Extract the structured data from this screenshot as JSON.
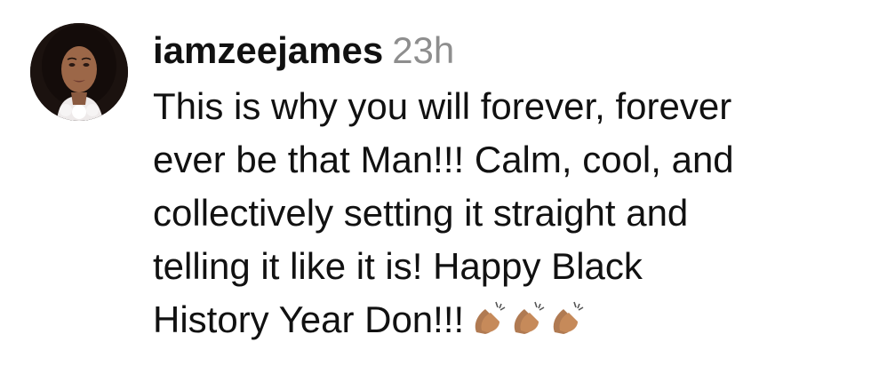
{
  "comment": {
    "username": "iamzeejames",
    "timestamp": "23h",
    "lines": [
      "This is why you will forever, forever",
      "ever be that Man!!! Calm, cool, and",
      "collectively setting it straight and",
      "telling it like it is! Happy Black",
      "History Year Don!!!"
    ],
    "emoji": "👏🏾👏🏾👏🏾",
    "emoji_icon": "clapping-hands-icon",
    "emoji_color": "#c68a5a"
  }
}
